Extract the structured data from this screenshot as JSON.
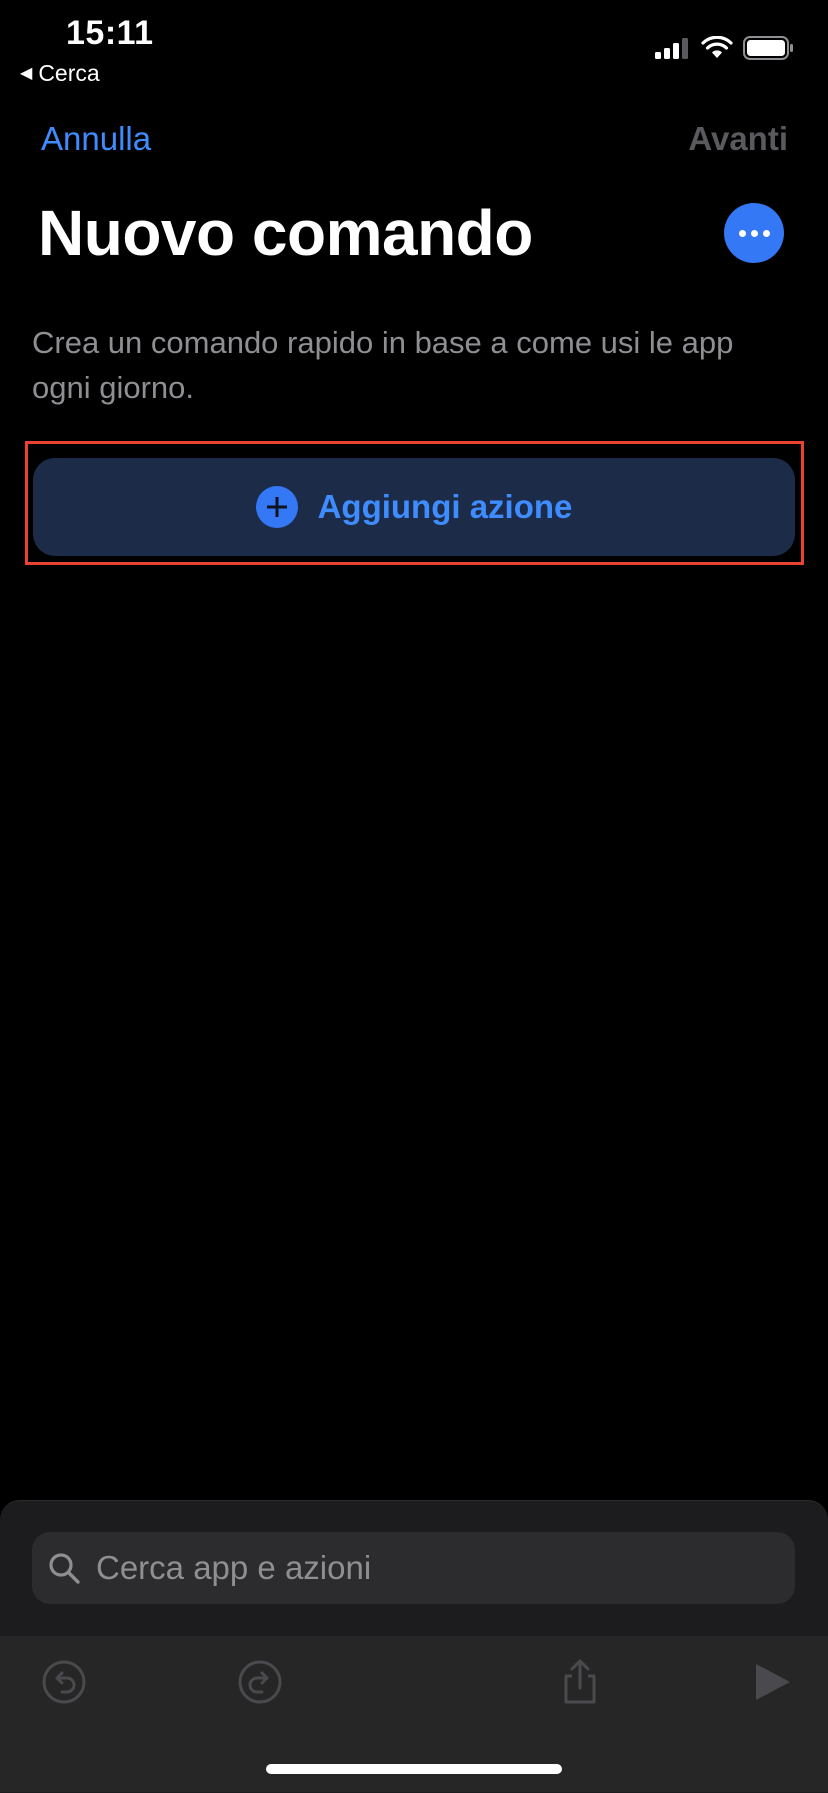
{
  "status_bar": {
    "time": "15:11",
    "back_label": "Cerca",
    "icons": [
      "cellular-signal-icon",
      "wifi-icon",
      "battery-icon"
    ]
  },
  "nav": {
    "cancel_label": "Annulla",
    "next_label": "Avanti"
  },
  "page": {
    "title": "Nuovo comando",
    "description": "Crea un comando rapido in base a come usi le app ogni giorno."
  },
  "add_action": {
    "label": "Aggiungi azione"
  },
  "search": {
    "placeholder": "Cerca app e azioni"
  },
  "toolbar": {
    "icons": [
      "undo-icon",
      "redo-icon",
      "share-icon",
      "play-icon"
    ]
  },
  "colors": {
    "accent": "#3f8cff",
    "highlight": "#e8442f",
    "background": "#000000",
    "button_bg": "#1b2b48",
    "muted_text": "#8e8e93"
  }
}
